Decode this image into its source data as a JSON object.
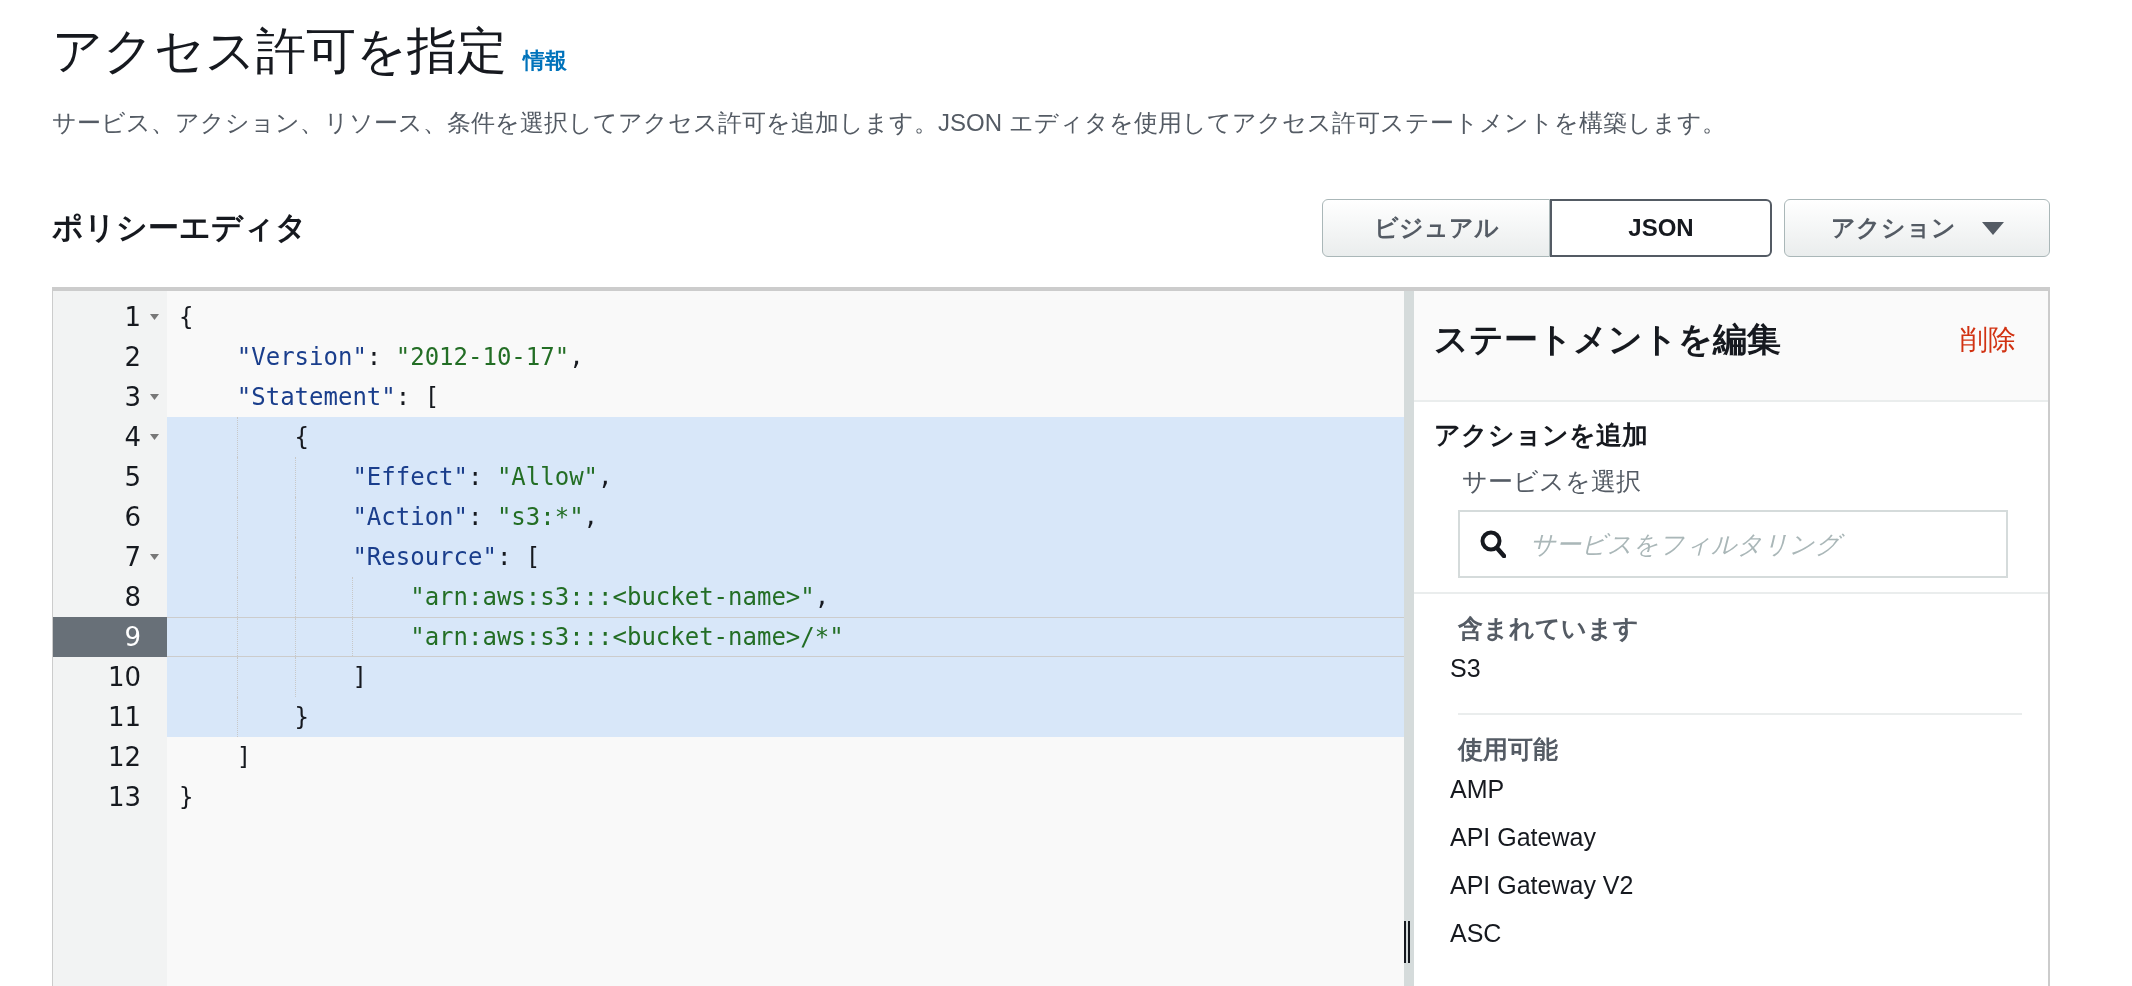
{
  "header": {
    "title": "アクセス許可を指定",
    "info_link": "情報",
    "description": "サービス、アクション、リソース、条件を選択してアクセス許可を追加します。JSON エディタを使用してアクセス許可ステートメントを構築します。"
  },
  "editor_title": "ポリシーエディタ",
  "mode_tabs": [
    {
      "label": "ビジュアル",
      "selected": false
    },
    {
      "label": "JSON",
      "selected": true
    }
  ],
  "actions_button": {
    "label": "アクション"
  },
  "code": {
    "lines": [
      {
        "number": "1",
        "foldable": true,
        "highlighted": false,
        "active": false,
        "tokens": [
          {
            "kind": "punct",
            "text": "{"
          }
        ]
      },
      {
        "number": "2",
        "foldable": false,
        "highlighted": false,
        "active": false,
        "tokens": [
          {
            "kind": "key",
            "text": "\"Version\""
          },
          {
            "kind": "punct",
            "text": ": "
          },
          {
            "kind": "string",
            "text": "\"2012-10-17\""
          },
          {
            "kind": "punct",
            "text": ","
          }
        ]
      },
      {
        "number": "3",
        "foldable": true,
        "highlighted": false,
        "active": false,
        "tokens": [
          {
            "kind": "key",
            "text": "\"Statement\""
          },
          {
            "kind": "punct",
            "text": ": ["
          }
        ]
      },
      {
        "number": "4",
        "foldable": true,
        "highlighted": true,
        "active": false,
        "tokens": [
          {
            "kind": "punct",
            "text": "{"
          }
        ]
      },
      {
        "number": "5",
        "foldable": false,
        "highlighted": true,
        "active": false,
        "tokens": [
          {
            "kind": "key",
            "text": "\"Effect\""
          },
          {
            "kind": "punct",
            "text": ": "
          },
          {
            "kind": "string",
            "text": "\"Allow\""
          },
          {
            "kind": "punct",
            "text": ","
          }
        ]
      },
      {
        "number": "6",
        "foldable": false,
        "highlighted": true,
        "active": false,
        "tokens": [
          {
            "kind": "key",
            "text": "\"Action\""
          },
          {
            "kind": "punct",
            "text": ": "
          },
          {
            "kind": "string",
            "text": "\"s3:*\""
          },
          {
            "kind": "punct",
            "text": ","
          }
        ]
      },
      {
        "number": "7",
        "foldable": true,
        "highlighted": true,
        "active": false,
        "tokens": [
          {
            "kind": "key",
            "text": "\"Resource\""
          },
          {
            "kind": "punct",
            "text": ": ["
          }
        ]
      },
      {
        "number": "8",
        "foldable": false,
        "highlighted": true,
        "active": false,
        "tokens": [
          {
            "kind": "string",
            "text": "\"arn:aws:s3:::<bucket-name>\""
          },
          {
            "kind": "punct",
            "text": ","
          }
        ]
      },
      {
        "number": "9",
        "foldable": false,
        "highlighted": true,
        "active": true,
        "tokens": [
          {
            "kind": "string",
            "text": "\"arn:aws:s3:::<bucket-name>/*\""
          }
        ]
      },
      {
        "number": "10",
        "foldable": false,
        "highlighted": true,
        "active": false,
        "tokens": [
          {
            "kind": "punct",
            "text": "]"
          }
        ]
      },
      {
        "number": "11",
        "foldable": false,
        "highlighted": true,
        "active": false,
        "tokens": [
          {
            "kind": "punct",
            "text": "}"
          }
        ]
      },
      {
        "number": "12",
        "foldable": false,
        "highlighted": false,
        "active": false,
        "tokens": [
          {
            "kind": "punct",
            "text": "]"
          }
        ]
      },
      {
        "number": "13",
        "foldable": false,
        "highlighted": false,
        "active": false,
        "tokens": [
          {
            "kind": "punct",
            "text": "}"
          }
        ]
      }
    ]
  },
  "statement_panel": {
    "title": "ステートメントを編集",
    "delete_link": "削除",
    "section_title": "アクションを追加",
    "service_label": "サービスを選択",
    "search": {
      "placeholder": "サービスをフィルタリング"
    },
    "groups": [
      {
        "heading": "含まれています",
        "items": [
          "S3"
        ]
      },
      {
        "heading": "使用可能",
        "items": [
          "AMP",
          "API Gateway",
          "API Gateway V2",
          "ASC"
        ]
      }
    ]
  }
}
